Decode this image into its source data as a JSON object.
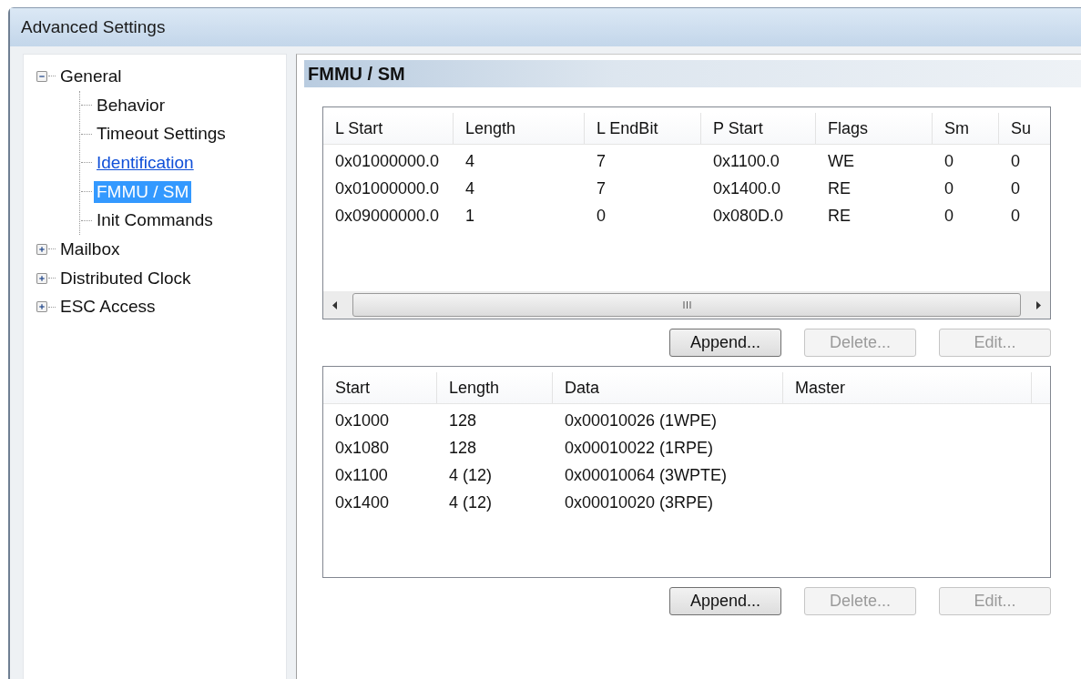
{
  "window": {
    "title": "Advanced Settings"
  },
  "tree": [
    {
      "label": "General",
      "expanded": true,
      "selected": false,
      "hovered": false,
      "children": [
        {
          "label": "Behavior",
          "selected": false,
          "hovered": false
        },
        {
          "label": "Timeout Settings",
          "selected": false,
          "hovered": false
        },
        {
          "label": "Identification",
          "selected": false,
          "hovered": true
        },
        {
          "label": "FMMU / SM",
          "selected": true,
          "hovered": false
        },
        {
          "label": "Init Commands",
          "selected": false,
          "hovered": false
        }
      ]
    },
    {
      "label": "Mailbox",
      "expanded": false,
      "selected": false,
      "hovered": false
    },
    {
      "label": "Distributed Clock",
      "expanded": false,
      "selected": false,
      "hovered": false
    },
    {
      "label": "ESC Access",
      "expanded": false,
      "selected": false,
      "hovered": false
    }
  ],
  "panel": {
    "title": "FMMU / SM",
    "fmmu_table": {
      "columns": [
        "L Start",
        "Length",
        "L EndBit",
        "P Start",
        "Flags",
        "Sm",
        "Su"
      ],
      "rows": [
        [
          "0x01000000.0",
          "4",
          "7",
          "0x1100.0",
          "WE",
          "0",
          "0"
        ],
        [
          "0x01000000.0",
          "4",
          "7",
          "0x1400.0",
          "RE",
          "0",
          "0"
        ],
        [
          "0x09000000.0",
          "1",
          "0",
          "0x080D.0",
          "RE",
          "0",
          "0"
        ]
      ]
    },
    "fmmu_buttons": [
      {
        "label": "Append...",
        "disabled": false
      },
      {
        "label": "Delete...",
        "disabled": true
      },
      {
        "label": "Edit...",
        "disabled": true
      }
    ],
    "sm_table": {
      "columns": [
        "Start",
        "Length",
        "Data",
        "Master"
      ],
      "rows": [
        [
          "0x1000",
          "128",
          "0x00010026 (1WPE)",
          ""
        ],
        [
          "0x1080",
          "128",
          "0x00010022 (1RPE)",
          ""
        ],
        [
          "0x1100",
          "4 (12)",
          "0x00010064 (3WPTE)",
          ""
        ],
        [
          "0x1400",
          "4 (12)",
          "0x00010020 (3RPE)",
          ""
        ]
      ]
    },
    "sm_buttons": [
      {
        "label": "Append...",
        "disabled": false
      },
      {
        "label": "Delete...",
        "disabled": true
      },
      {
        "label": "Edit...",
        "disabled": true
      }
    ]
  }
}
